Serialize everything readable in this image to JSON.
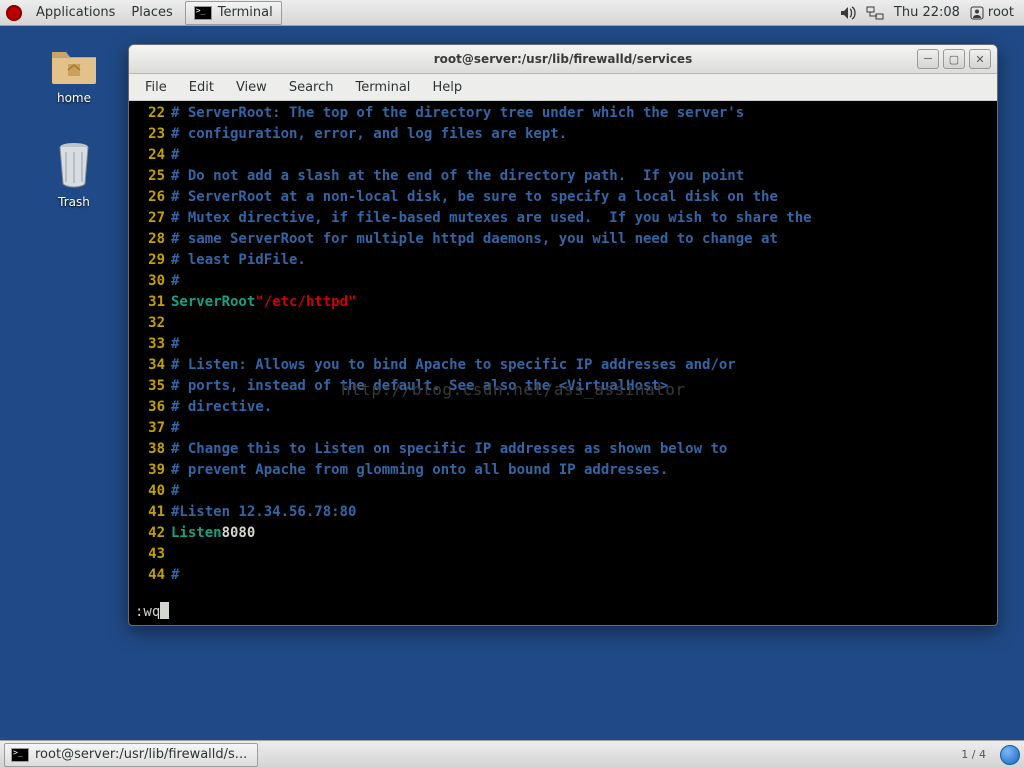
{
  "top_panel": {
    "menus": {
      "applications": "Applications",
      "places": "Places"
    },
    "taskbar_app": "Terminal",
    "clock": "Thu 22:08",
    "user": "root"
  },
  "desktop": {
    "home": "home",
    "trash": "Trash"
  },
  "window": {
    "title": "root@server:/usr/lib/firewalld/services",
    "menus": [
      "File",
      "Edit",
      "View",
      "Search",
      "Terminal",
      "Help"
    ]
  },
  "editor": {
    "status": ":wq",
    "watermark": "http://blog.csdn.net/ass_assinator",
    "lines": [
      {
        "n": 22,
        "t": "comment",
        "txt": "# ServerRoot: The top of the directory tree under which the server's"
      },
      {
        "n": 23,
        "t": "comment",
        "txt": "# configuration, error, and log files are kept."
      },
      {
        "n": 24,
        "t": "comment",
        "txt": "#"
      },
      {
        "n": 25,
        "t": "comment",
        "txt": "# Do not add a slash at the end of the directory path.  If you point"
      },
      {
        "n": 26,
        "t": "comment",
        "txt": "# ServerRoot at a non-local disk, be sure to specify a local disk on the"
      },
      {
        "n": 27,
        "t": "comment",
        "txt": "# Mutex directive, if file-based mutexes are used.  If you wish to share the"
      },
      {
        "n": 28,
        "t": "comment",
        "txt": "# same ServerRoot for multiple httpd daemons, you will need to change at"
      },
      {
        "n": 29,
        "t": "comment",
        "txt": "# least PidFile."
      },
      {
        "n": 30,
        "t": "comment",
        "txt": "#"
      },
      {
        "n": 31,
        "t": "kv",
        "key": "ServerRoot",
        "val": "\"/etc/httpd\""
      },
      {
        "n": 32,
        "t": "blank",
        "txt": ""
      },
      {
        "n": 33,
        "t": "comment",
        "txt": "#"
      },
      {
        "n": 34,
        "t": "comment",
        "txt": "# Listen: Allows you to bind Apache to specific IP addresses and/or"
      },
      {
        "n": 35,
        "t": "comment",
        "txt": "# ports, instead of the default. See also the <VirtualHost>"
      },
      {
        "n": 36,
        "t": "comment",
        "txt": "# directive."
      },
      {
        "n": 37,
        "t": "comment",
        "txt": "#"
      },
      {
        "n": 38,
        "t": "comment",
        "txt": "# Change this to Listen on specific IP addresses as shown below to"
      },
      {
        "n": 39,
        "t": "comment",
        "txt": "# prevent Apache from glomming onto all bound IP addresses."
      },
      {
        "n": 40,
        "t": "comment",
        "txt": "#"
      },
      {
        "n": 41,
        "t": "comment",
        "txt": "#Listen 12.34.56.78:80"
      },
      {
        "n": 42,
        "t": "kn",
        "key": "Listen",
        "num": "8080"
      },
      {
        "n": 43,
        "t": "blank",
        "txt": ""
      },
      {
        "n": 44,
        "t": "comment",
        "txt": "#"
      }
    ]
  },
  "bottom_panel": {
    "task": "root@server:/usr/lib/firewalld/s...",
    "workspace": "1 / 4"
  }
}
